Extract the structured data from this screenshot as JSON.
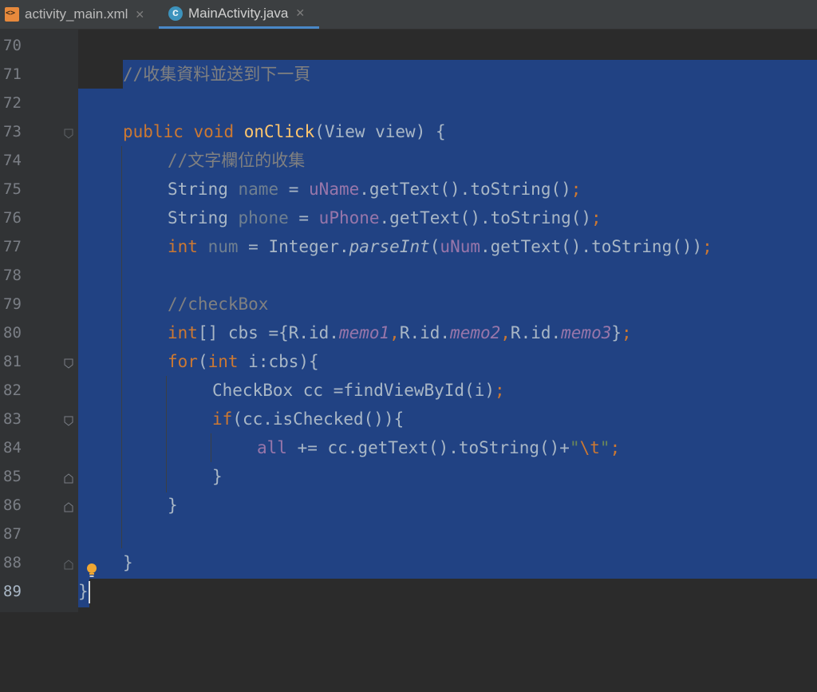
{
  "tabs": [
    {
      "label": "activity_main.xml",
      "icon": "xml-file-icon",
      "active": false
    },
    {
      "label": "MainActivity.java",
      "icon": "java-class-icon",
      "active": true
    }
  ],
  "tab_close_glyph": "✕",
  "line_numbers": [
    "70",
    "71",
    "72",
    "73",
    "74",
    "75",
    "76",
    "77",
    "78",
    "79",
    "80",
    "81",
    "82",
    "83",
    "84",
    "85",
    "86",
    "87",
    "88",
    "89"
  ],
  "code": {
    "l71_comment": "//收集資料並送到下一頁",
    "l73": {
      "kw1": "public",
      "kw2": "void",
      "fn": "onClick",
      "rest": "(View view) {"
    },
    "l74_comment": "//文字欄位的收集",
    "l75": {
      "type": "String",
      "var": "name",
      "eq": " = ",
      "field": "uName",
      "rest": ".getText().toString()",
      "semi": ";"
    },
    "l76": {
      "type": "String",
      "var": "phone",
      "eq": " = ",
      "field": "uPhone",
      "rest": ".getText().toString()",
      "semi": ";"
    },
    "l77": {
      "type": "int",
      "var": "num",
      "eq": " = Integer.",
      "method": "parseInt",
      "open": "(",
      "field": "uNum",
      "rest": ".getText().toString())",
      "semi": ";"
    },
    "l79_comment": "//checkBox",
    "l80": {
      "type": "int",
      "a": "[] cbs ={R.id.",
      "m1": "memo1",
      "c1": ",",
      "b": "R.id.",
      "m2": "memo2",
      "c2": ",",
      "c": "R.id.",
      "m3": "memo3",
      "d": "}",
      "semi": ";"
    },
    "l81": {
      "kw": "for",
      "a": "(",
      "kw2": "int",
      "b": " i:cbs){"
    },
    "l82": {
      "a": "CheckBox cc =findViewById(i)",
      "semi": ";"
    },
    "l83": {
      "kw": "if",
      "b": "(cc.isChecked()){"
    },
    "l84": {
      "field": "all",
      "a": " += cc.getText().toString()+",
      "q1": "\"",
      "esc": "\\t",
      "q2": "\"",
      "semi": ";"
    },
    "l85": "}",
    "l86": "}",
    "l88": "}",
    "l89": "}"
  },
  "colors": {
    "background": "#2b2b2b",
    "gutter": "#313335",
    "selection": "#214283",
    "keyword": "#cc7832",
    "function": "#ffc66d",
    "field": "#9876aa",
    "comment": "#808080",
    "string": "#6a8759",
    "text": "#a9b7c6",
    "tab_underline": "#4a88c7"
  },
  "gutter_icons": [
    "fold-marker-icon",
    "intention-bulb-icon"
  ]
}
